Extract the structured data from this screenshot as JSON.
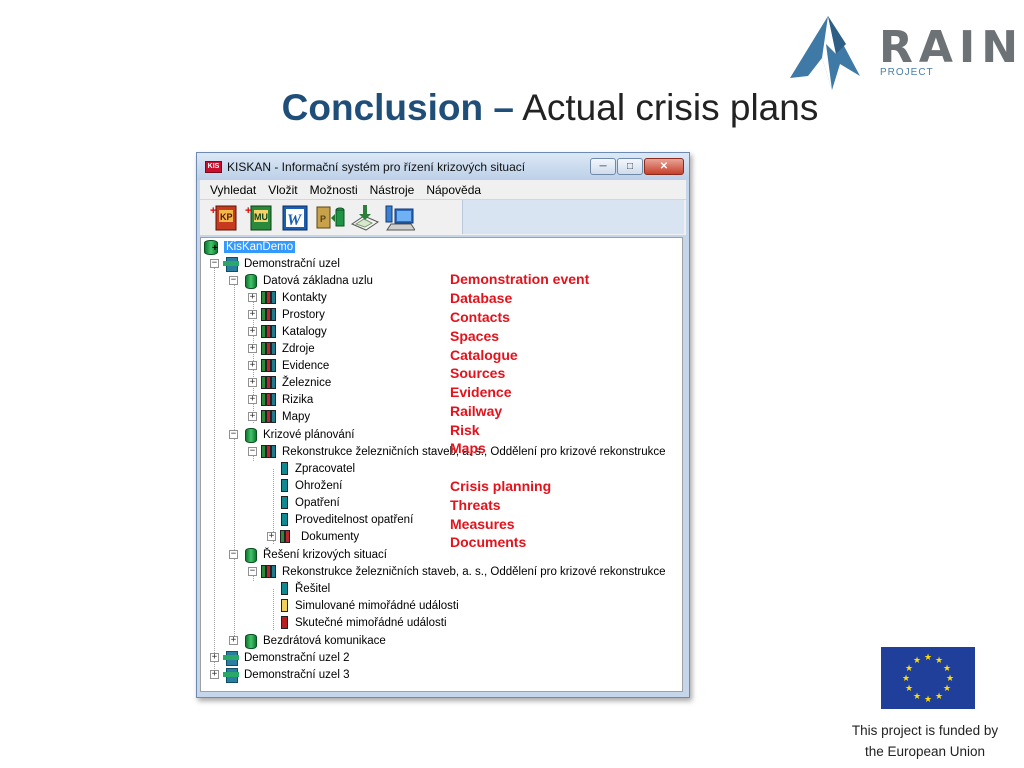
{
  "logo": {
    "word": "RAIN",
    "sub": "PROJECT"
  },
  "slide": {
    "title_strong": "Conclusion –",
    "title_light": " Actual crisis plans"
  },
  "window": {
    "app_icon": "KIS",
    "title": "KISKAN - Informační systém pro řízení krizových situací",
    "menu": [
      "Vyhledat",
      "Vložit",
      "Možnosti",
      "Nástroje",
      "Nápověda"
    ],
    "toolbar": {
      "buttons": [
        {
          "name": "new-kp-button",
          "label": "KP"
        },
        {
          "name": "new-mu-button",
          "label": "MU"
        },
        {
          "name": "word-button",
          "label": "W"
        },
        {
          "name": "pdf-db-button",
          "label": "P"
        },
        {
          "name": "map-export-button",
          "label": ""
        },
        {
          "name": "computer-button",
          "label": ""
        }
      ]
    },
    "tree": {
      "root": "KisKanDemo",
      "node1": "Demonstrační uzel",
      "db": "Datová základna uzlu",
      "kontakty": "Kontakty",
      "prostory": "Prostory",
      "katalogy": "Katalogy",
      "zdroje": "Zdroje",
      "evidence": "Evidence",
      "zeleznice": "Železnice",
      "rizika": "Rizika",
      "mapy": "Mapy",
      "krizove": "Krizové plánování",
      "rekon1": "Rekonstrukce železničních staveb, a. s., Oddělení pro krizové rekonstrukce",
      "zpracovatel": "Zpracovatel",
      "ohrozeni": "Ohrožení",
      "opatreni": "Opatření",
      "proveditelnost": "Proveditelnost opatření",
      "dokumenty": "Dokumenty",
      "reseni": "Řešení krizových situací",
      "rekon2": "Rekonstrukce železničních staveb, a. s., Oddělení pro krizové rekonstrukce",
      "resitel": "Řešitel",
      "simulovane": "Simulované mimořádné události",
      "skutecne": "Skutečné mimořádné události",
      "bezdratova": "Bezdrátová komunikace",
      "node2": "Demonstrační uzel 2",
      "node3": "Demonstrační uzel 3"
    }
  },
  "annotations": {
    "group1": [
      "Demonstration event",
      "Database",
      "Contacts",
      "Spaces",
      "Catalogue",
      "Sources",
      "Evidence",
      "Railway",
      "Risk",
      "Maps"
    ],
    "group2": [
      "Crisis planning",
      "Threats",
      "Measures",
      "Documents"
    ],
    "color": "#e3121b"
  },
  "footer": {
    "funded_line1": "This project is funded by",
    "funded_line2": "the European Union"
  },
  "colors": {
    "title_blue": "#1f4e79",
    "eu_blue": "#1f3f9a",
    "eu_yellow": "#ffdd00",
    "selection": "#3399ff"
  }
}
